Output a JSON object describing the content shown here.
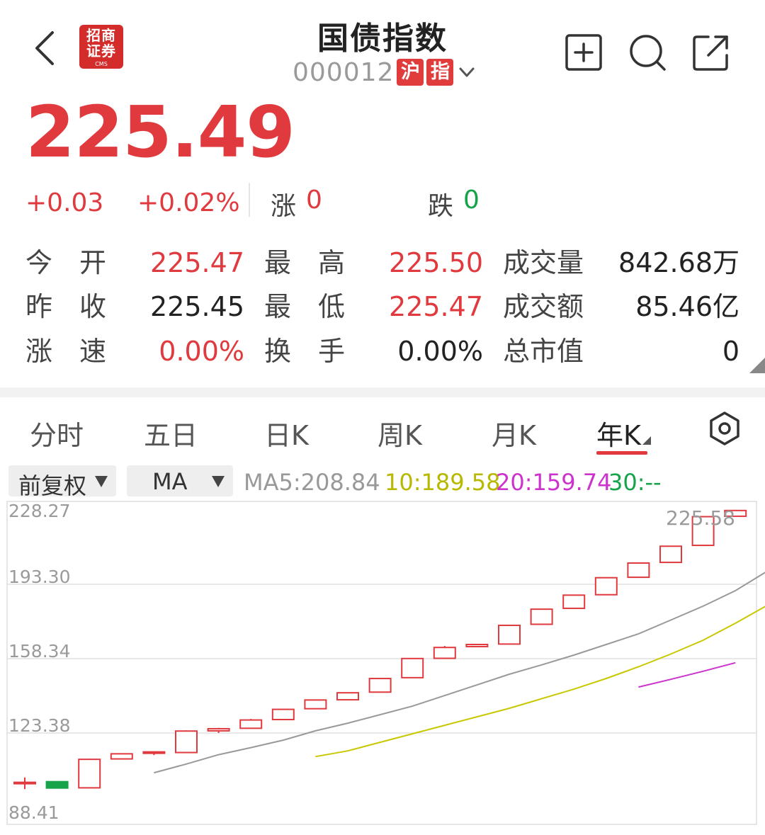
{
  "header": {
    "title": "国债指数",
    "code": "000012",
    "market_tag_1": "沪",
    "market_tag_2": "指",
    "logo_line1": "招商",
    "logo_line2": "证券",
    "logo_sub": "CMS"
  },
  "quote": {
    "price": "225.49",
    "change": "+0.03",
    "change_pct": "+0.02%",
    "up_label": "涨",
    "up_count": "0",
    "down_label": "跌",
    "down_count": "0"
  },
  "stats": {
    "row1": {
      "l1": "今　开",
      "v1": "225.47",
      "l2": "最　高",
      "v2": "225.50",
      "l3": "成交量",
      "v3": "842.68万"
    },
    "row2": {
      "l1": "昨　收",
      "v1": "225.45",
      "l2": "最　低",
      "v2": "225.47",
      "l3": "成交额",
      "v3": "85.46亿"
    },
    "row3": {
      "l1": "涨　速",
      "v1": "0.00%",
      "l2": "换　手",
      "v2": "0.00%",
      "l3": "总市值",
      "v3": "0"
    }
  },
  "tabs": [
    "分时",
    "五日",
    "日K",
    "周K",
    "月K",
    "年K"
  ],
  "active_tab": "年K",
  "controls": {
    "adjust": "前复权",
    "indicator": "MA",
    "ma5_label": "MA5:",
    "ma5": "208.84",
    "ma10_label": "10:",
    "ma10": "189.58",
    "ma20_label": "20:",
    "ma20": "159.74",
    "ma30_label": "30:",
    "ma30": "--"
  },
  "colors": {
    "up": "#e0393e",
    "down": "#16a34a",
    "ma5": "#999999",
    "ma10": "#c8c800",
    "ma20": "#cc33cc"
  },
  "chart_data": {
    "type": "candlestick",
    "y_ticks": [
      "228.27",
      "193.30",
      "158.34",
      "123.38",
      "88.41"
    ],
    "ylim": [
      88.41,
      228.27
    ],
    "max_label": "225.58",
    "candles": [
      {
        "o": 100.2,
        "c": 100.2,
        "h": 102.5,
        "l": 97.0
      },
      {
        "o": 100.5,
        "c": 97.5,
        "h": 100.5,
        "l": 97.5
      },
      {
        "o": 97.6,
        "c": 111.0,
        "h": 111.3,
        "l": 97.6
      },
      {
        "o": 111.2,
        "c": 113.6,
        "h": 113.8,
        "l": 111.2
      },
      {
        "o": 114.5,
        "c": 114.5,
        "h": 114.5,
        "l": 113.0
      },
      {
        "o": 114.2,
        "c": 124.3,
        "h": 124.6,
        "l": 114.2
      },
      {
        "o": 124.4,
        "c": 125.4,
        "h": 125.8,
        "l": 123.4
      },
      {
        "o": 125.6,
        "c": 129.5,
        "h": 130.0,
        "l": 125.6
      },
      {
        "o": 129.7,
        "c": 134.5,
        "h": 134.8,
        "l": 129.7
      },
      {
        "o": 134.8,
        "c": 138.9,
        "h": 139.2,
        "l": 134.8
      },
      {
        "o": 139.0,
        "c": 142.3,
        "h": 142.5,
        "l": 139.0
      },
      {
        "o": 142.6,
        "c": 149.0,
        "h": 149.3,
        "l": 142.6
      },
      {
        "o": 149.4,
        "c": 158.4,
        "h": 158.6,
        "l": 149.4
      },
      {
        "o": 158.5,
        "c": 163.6,
        "h": 164.3,
        "l": 158.5
      },
      {
        "o": 164.0,
        "c": 165.0,
        "h": 165.3,
        "l": 164.0
      },
      {
        "o": 165.2,
        "c": 174.0,
        "h": 174.3,
        "l": 165.2
      },
      {
        "o": 174.5,
        "c": 181.6,
        "h": 181.8,
        "l": 174.5
      },
      {
        "o": 182.0,
        "c": 188.2,
        "h": 188.4,
        "l": 182.0
      },
      {
        "o": 188.4,
        "c": 196.4,
        "h": 196.6,
        "l": 188.4
      },
      {
        "o": 196.6,
        "c": 203.3,
        "h": 203.5,
        "l": 196.6
      },
      {
        "o": 203.6,
        "c": 211.2,
        "h": 211.4,
        "l": 203.6
      },
      {
        "o": 211.6,
        "c": 225.1,
        "h": 225.3,
        "l": 211.6
      },
      {
        "o": 225.3,
        "c": 228.0,
        "h": 228.3,
        "l": 225.3
      }
    ],
    "ma5": {
      "start": 4,
      "values": [
        104.7,
        108.8,
        113.2,
        116.5,
        120.0,
        124.4,
        128.0,
        132.0,
        136.0,
        141.0,
        146.0,
        151.0,
        155.4,
        160.0,
        165.0,
        170.0,
        176.5,
        183.0,
        190.3,
        199.6
      ]
    },
    "ma10": {
      "start": 9,
      "values": [
        112.3,
        115.0,
        119.0,
        123.0,
        127.0,
        131.0,
        135.0,
        139.5,
        144.0,
        149.0,
        154.5,
        160.5,
        167.0,
        175.0,
        183.5
      ]
    },
    "ma20": {
      "start": 19,
      "values": [
        145.0,
        148.6,
        152.4,
        156.4
      ]
    }
  }
}
